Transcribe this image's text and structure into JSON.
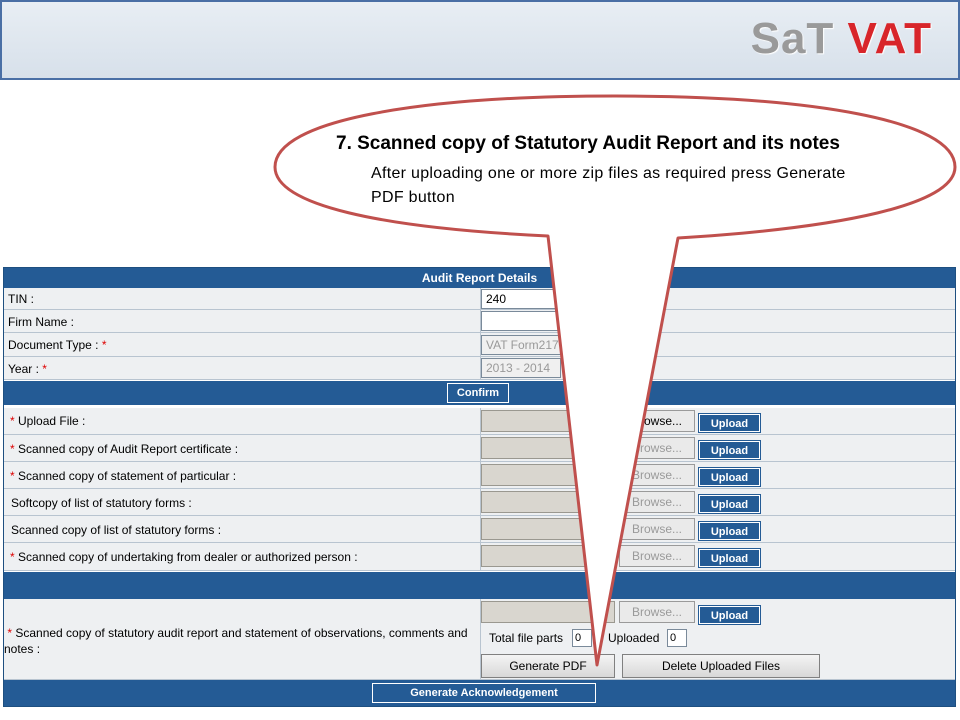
{
  "header": {
    "logo_part1": "SaT",
    "logo_part2": "VAT"
  },
  "callout": {
    "title": "7.   Scanned copy of Statutory Audit Report and its notes",
    "description": "After uploading one or more zip files as required press Generate PDF button"
  },
  "form": {
    "title": "Audit Report Details",
    "fields": {
      "tin_label": "TIN :",
      "tin_value": "240",
      "firm_label": "Firm Name :",
      "firm_value": "",
      "doctype_label": "Document Type : ",
      "doctype_value": "VAT Form217",
      "year_label": "Year : ",
      "year_value": "2013 - 2014",
      "required_mark": "*"
    },
    "confirm_label": "Confirm",
    "uploads": [
      {
        "label": "Upload File :",
        "required": true,
        "browse": "Browse...",
        "upload": "Upload"
      },
      {
        "label": "Scanned copy of Audit Report certificate :",
        "required": true,
        "browse": "Browse...",
        "upload": "Upload"
      },
      {
        "label": "Scanned copy of statement of particular :",
        "required": true,
        "browse": "Browse...",
        "upload": "Upload"
      },
      {
        "label": "Softcopy of list of statutory forms :",
        "required": false,
        "browse": "Browse...",
        "upload": "Upload"
      },
      {
        "label": "Scanned copy of list of statutory forms :",
        "required": false,
        "browse": "Browse...",
        "upload": "Upload"
      },
      {
        "label": "Scanned copy of undertaking from dealer or authorized person :",
        "required": true,
        "browse": "Browse...",
        "upload": "Upload"
      }
    ],
    "statutory": {
      "label": "Scanned copy of statutory audit report and statement of observations, comments and notes :",
      "browse": "Browse...",
      "upload": "Upload",
      "total_parts_label": "Total file parts",
      "total_parts_value": "0",
      "uploaded_label": "Uploaded",
      "uploaded_value": "0",
      "generate_pdf": "Generate PDF",
      "delete_uploaded": "Delete Uploaded Files"
    },
    "generate_ack": "Generate Acknowledgement"
  }
}
